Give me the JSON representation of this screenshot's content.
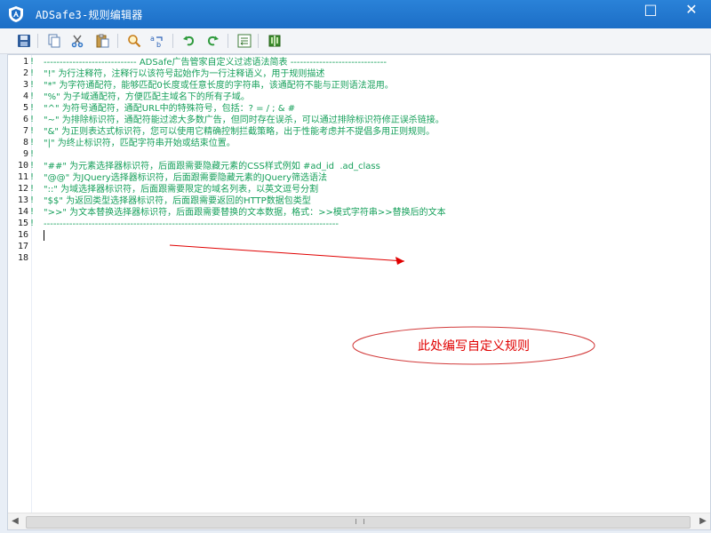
{
  "window": {
    "title": "ADSafe3-规则编辑器",
    "app_icon": "adsafe-shield-icon",
    "controls": {
      "maximize_icon": "maximize-icon",
      "close_icon": "close-icon",
      "maximize_symbol": "□",
      "close_symbol": "✕"
    }
  },
  "toolbar": {
    "buttons": [
      {
        "icon": "save-icon"
      },
      {
        "icon": "copy-icon"
      },
      {
        "icon": "cut-icon"
      },
      {
        "icon": "paste-icon"
      },
      {
        "icon": "find-icon"
      },
      {
        "icon": "replace-icon"
      },
      {
        "icon": "undo-icon"
      },
      {
        "icon": "redo-icon"
      },
      {
        "icon": "import-icon"
      },
      {
        "icon": "help-book-icon"
      }
    ]
  },
  "editor": {
    "line_numbers": [
      "1",
      "2",
      "3",
      "4",
      "5",
      "6",
      "7",
      "8",
      "9",
      "10",
      "11",
      "12",
      "13",
      "14",
      "15",
      "16",
      "17",
      "18"
    ],
    "markers": [
      "!",
      "!",
      "!",
      "!",
      "!",
      "!",
      "!",
      "!",
      "!",
      "!",
      "!",
      "!",
      "!",
      "!",
      "!",
      "",
      "",
      ""
    ],
    "lines": [
      "----------------------------- ADSafe广告管家自定义过滤语法简表 ------------------------------",
      "\"!\" 为行注释符，注释行以该符号起始作为一行注释语义，用于规则描述",
      "\"*\" 为字符通配符，能够匹配0长度或任意长度的字符串，该通配符不能与正则语法混用。",
      "\"%\" 为子域通配符，方便匹配主域名下的所有子域。",
      "\"^\" 为符号通配符，通配URL中的特殊符号，包括：? = / ; & #",
      "\"~\" 为排除标识符，通配符能过滤大多数广告，但同时存在误杀，可以通过排除标识符修正误杀链接。",
      "\"&\" 为正则表达式标识符，您可以使用它精确控制拦截策略，出于性能考虑并不提倡多用正则规则。",
      "\"|\" 为终止标识符，匹配字符串开始或结束位置。",
      "",
      "\"##\" 为元素选择器标识符，后面跟需要隐藏元素的CSS样式例如 #ad_id  .ad_class",
      "\"@@\" 为JQuery选择器标识符，后面跟需要隐藏元素的JQuery筛选语法",
      "\"::\" 为域选择器标识符，后面跟需要限定的域名列表，以英文逗号分割",
      "\"$$\" 为返回类型选择器标识符，后面跟需要返回的HTTP数据包类型",
      "\">>\" 为文本替换选择器标识符，后面跟需要替换的文本数据，格式：>>模式字符串>>替换后的文本",
      "--------------------------------------------------------------------------------------------",
      "",
      "",
      ""
    ],
    "annotation": "此处编写自定义规则",
    "annotation_color": "#e00000",
    "code_color": "#16a05b"
  },
  "scrollbar": {
    "left_arrow_icon": "scroll-left-icon",
    "right_arrow_icon": "scroll-right-icon",
    "left_symbol": "◀",
    "right_symbol": "▶"
  }
}
